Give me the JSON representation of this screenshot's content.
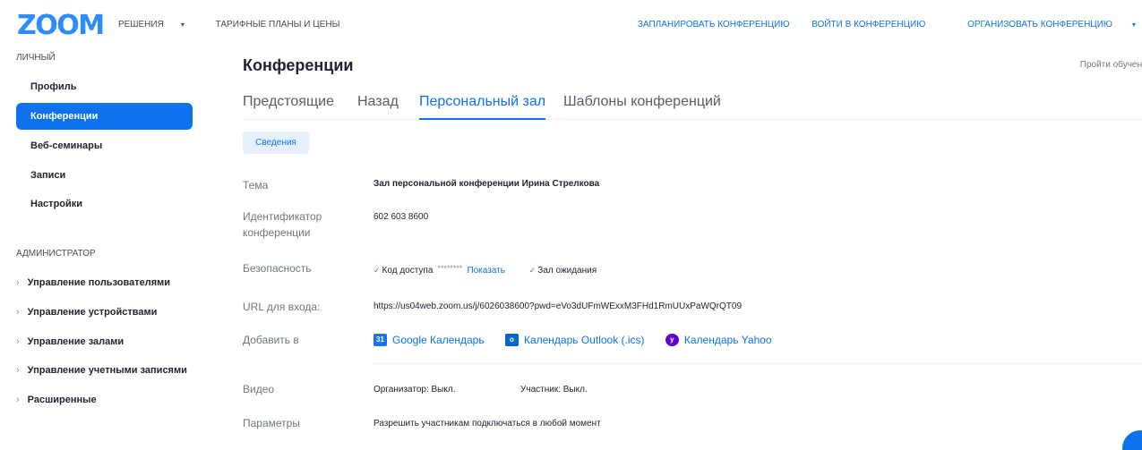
{
  "header": {
    "logo": "ZOOM",
    "left_nav": [
      {
        "label": "РЕШЕНИЯ",
        "has_caret": true
      },
      {
        "label": "ТАРИФНЫЕ ПЛАНЫ И ЦЕНЫ",
        "has_caret": false
      }
    ],
    "right_nav": [
      {
        "label": "ЗАПЛАНИРОВАТЬ КОНФЕРЕНЦИЮ"
      },
      {
        "label": "ВОЙТИ В КОНФЕРЕНЦИЮ"
      },
      {
        "label": "ОРГАНИЗОВАТЬ КОНФЕРЕНЦИЮ"
      }
    ]
  },
  "sidebar": {
    "personal_heading": "ЛИЧНЫЙ",
    "items": [
      {
        "label": "Профиль"
      },
      {
        "label": "Конференции",
        "active": true
      },
      {
        "label": "Веб-семинары"
      },
      {
        "label": "Записи"
      },
      {
        "label": "Настройки"
      }
    ],
    "admin_heading": "АДМИНИСТРАТОР",
    "admin_items": [
      {
        "label": "Управление пользователями"
      },
      {
        "label": "Управление устройствами"
      },
      {
        "label": "Управление залами"
      },
      {
        "label": "Управление учетными записями"
      },
      {
        "label": "Расширенные"
      }
    ]
  },
  "main": {
    "title": "Конференции",
    "tutorial_link": "Пройти обучен",
    "tabs": [
      {
        "label": "Предстоящие"
      },
      {
        "label": "Назад"
      },
      {
        "label": "Персональный зал",
        "active": true
      },
      {
        "label": "Шаблоны конференций"
      }
    ],
    "details_button": "Сведения",
    "fields": {
      "topic_label": "Тема",
      "topic_value": "Зал персональной конференции Ирина Стрелкова",
      "id_label_1": "Идентификатор",
      "id_label_2": "конференции",
      "id_value": "602 603 8600",
      "security_label": "Безопасность",
      "passcode_label": "Код доступа",
      "passcode_mask": "********",
      "show_link": "Показать",
      "waiting_room": "Зал ожидания",
      "url_label": "URL для входа:",
      "url_value": "https://us04web.zoom.us/j/6026038600?pwd=eVo3dUFmWExxM3FHd1RmUUxPaWQrQT09",
      "add_to_label": "Добавить в",
      "calendars": {
        "google": "Google Календарь",
        "outlook": "Календарь Outlook (.ics)",
        "yahoo": "Календарь Yahoo"
      },
      "video_label": "Видео",
      "host_video": "Организатор: Выкл.",
      "participant_video": "Участник: Выкл.",
      "options_label": "Параметры",
      "options_value": "Разрешить участникам подключаться в любой момент"
    }
  },
  "colors": {
    "accent": "#0e72ed",
    "logo": "#2d8cff"
  }
}
